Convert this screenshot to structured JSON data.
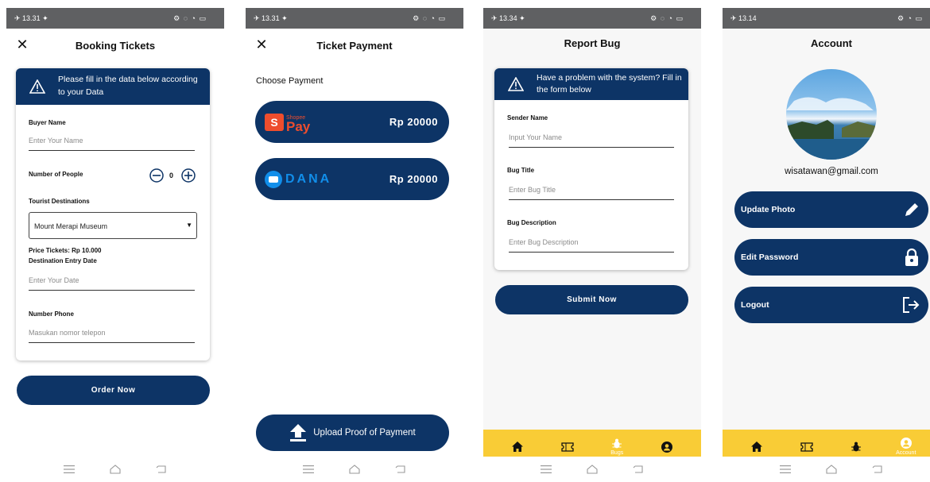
{
  "screens": {
    "booking": {
      "status_time": "13.31",
      "status_icons": "⚙ ◌ ◔ ▭",
      "title": "Booking Tickets",
      "notice": "Please fill in the data below according to your Data",
      "buyer_label": "Buyer Name",
      "buyer_placeholder": "Enter Your Name",
      "people_label": "Number of People",
      "people_count": "0",
      "destination_label": "Tourist Destinations",
      "destination_value": "Mount Merapi Museum",
      "price_text": "Price Tickets: Rp 10.000",
      "date_label": "Destination Entry Date",
      "date_placeholder": "Enter Your Date",
      "phone_label": "Number Phone",
      "phone_placeholder": "Masukan nomor telepon",
      "order_button": "Order Now"
    },
    "payment": {
      "status_time": "13.31",
      "status_icons": "⚙ ◌ ◔ ▭",
      "title": "Ticket Payment",
      "choose_label": "Choose Payment",
      "options": [
        {
          "logo_text": "ShopeePay",
          "shopee_small": "Shopee",
          "shopee_big": "Pay",
          "shopee_s": "S",
          "amount": "Rp 20000"
        },
        {
          "logo_text": "DANA",
          "amount": "Rp 20000"
        }
      ],
      "upload_button": "Upload Proof of Payment"
    },
    "report": {
      "status_time": "13.34",
      "status_icons": "⚙ ◌ ◔ ▭",
      "title": "Report Bug",
      "notice": "Have a problem with the system? Fill in the form below",
      "sender_label": "Sender Name",
      "sender_placeholder": "Input Your Name",
      "bug_title_label": "Bug Title",
      "bug_title_placeholder": "Enter Bug Title",
      "bug_desc_label": "Bug Description",
      "bug_desc_placeholder": "Enter Bug Description",
      "submit_button": "Submit Now",
      "tab_bugs_label": "Bugs"
    },
    "account": {
      "status_time": "13.14",
      "status_icons": "⚙ ◔ ▭",
      "title": "Account",
      "email": "wisatawan@gmail.com",
      "update_photo": "Update Photo",
      "edit_password": "Edit Password",
      "logout": "Logout",
      "tab_account_label": "Account"
    }
  },
  "colors": {
    "navy": "#0d3466",
    "yellow_tab": "#f9cc36",
    "status_bar": "#5f6062",
    "shopee_red": "#ee4d2d",
    "dana_blue": "#118eea"
  },
  "icons": [
    "close-icon",
    "warning-icon",
    "minus-icon",
    "plus-icon",
    "dropdown-icon",
    "upload-icon",
    "home-icon",
    "ticket-icon",
    "bug-icon",
    "account-icon",
    "pencil-icon",
    "lock-icon",
    "logout-icon",
    "menu-icon",
    "android-home-icon",
    "back-icon"
  ]
}
